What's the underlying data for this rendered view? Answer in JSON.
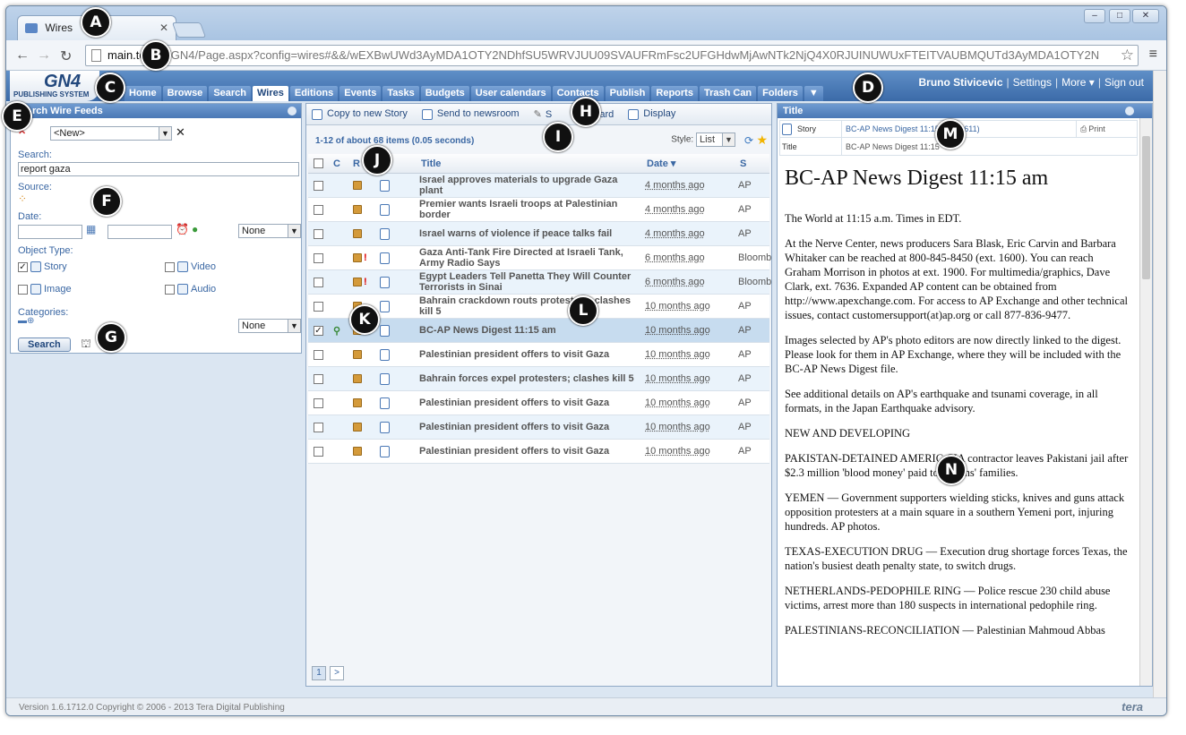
{
  "browser": {
    "tab_title": "Wires",
    "url_host": "main.te",
    "url_rest": "com/GN4/Page.aspx?config=wires#&&/wEXBwUWd3AyMDA1OTY2NDhfSU5WRVJUU09SVAUFRmFsc2UFGHdwMjAwNTk2NjQ4X0RJUINUWUxFTEITVAUBMQUTd3AyMDA1OTY2N"
  },
  "app": {
    "logo_text": "GN4",
    "logo_sub": "PUBLISHING SYSTEM",
    "nav": [
      "Home",
      "Browse",
      "Search",
      "Wires",
      "Editions",
      "Events",
      "Tasks",
      "Budgets",
      "User calendars",
      "Contacts",
      "Publish",
      "Reports",
      "Trash Can",
      "Folders",
      "▼"
    ],
    "active_nav": "Wires",
    "user": "Bruno Stivicevic",
    "settings": "Settings",
    "more": "More ▾",
    "signout": "Sign out"
  },
  "search_panel": {
    "title": "rch Wire Feeds",
    "saved_search": "<New>",
    "search_label": "Search:",
    "search_value": "report gaza",
    "source_label": "Source:",
    "date_label": "Date:",
    "date_mode": "None",
    "object_type_label": "Object Type:",
    "types": [
      {
        "label": "Story",
        "checked": true
      },
      {
        "label": "Video",
        "checked": false
      },
      {
        "label": "Image",
        "checked": false
      },
      {
        "label": "Audio",
        "checked": false
      }
    ],
    "categories_label": "Categories:",
    "categories_mode": "None",
    "search_button": "Search"
  },
  "results_panel": {
    "toolbar": [
      "Copy to new Story",
      "Send to newsroom",
      "S",
      "Clipboard",
      "Display"
    ],
    "info": "1-12 of about 68 items (0.05 seconds)",
    "style_label": "Style:",
    "style_value": "List",
    "columns": {
      "c": "C",
      "r": "R",
      "title": "Title",
      "date": "Date ▾",
      "source": "S"
    },
    "rows": [
      {
        "title": "Israel approves materials to upgrade Gaza plant",
        "date": "4 months ago",
        "source": "AP",
        "flag": false,
        "checked": false
      },
      {
        "title": "Premier wants Israeli troops at Palestinian border",
        "date": "4 months ago",
        "source": "AP",
        "flag": false,
        "checked": false
      },
      {
        "title": "Israel warns of violence if peace talks fail",
        "date": "4 months ago",
        "source": "AP",
        "flag": false,
        "checked": false
      },
      {
        "title": "Gaza Anti-Tank Fire Directed at Israeli Tank, Army Radio Says",
        "date": "6 months ago",
        "source": "Bloomb",
        "flag": true,
        "checked": false
      },
      {
        "title": "Egypt Leaders Tell Panetta They Will Counter Terrorists in Sinai",
        "date": "6 months ago",
        "source": "Bloomb",
        "flag": true,
        "checked": false
      },
      {
        "title": "Bahrain crackdown routs protesters; clashes kill 5",
        "date": "10 months ago",
        "source": "AP",
        "flag": false,
        "checked": false
      },
      {
        "title": "BC-AP News Digest 11:15 am",
        "date": "10 months ago",
        "source": "AP",
        "flag": false,
        "checked": true
      },
      {
        "title": "Palestinian president offers to visit Gaza",
        "date": "10 months ago",
        "source": "AP",
        "flag": false,
        "checked": false
      },
      {
        "title": "Bahrain forces expel protesters; clashes kill 5",
        "date": "10 months ago",
        "source": "AP",
        "flag": false,
        "checked": false
      },
      {
        "title": "Palestinian president offers to visit Gaza",
        "date": "10 months ago",
        "source": "AP",
        "flag": false,
        "checked": false
      },
      {
        "title": "Palestinian president offers to visit Gaza",
        "date": "10 months ago",
        "source": "AP",
        "flag": false,
        "checked": false
      },
      {
        "title": "Palestinian president offers to visit Gaza",
        "date": "10 months ago",
        "source": "AP",
        "flag": false,
        "checked": false
      }
    ],
    "pages": [
      "1",
      ">"
    ]
  },
  "preview_panel": {
    "title": "Title",
    "meta": [
      {
        "key": "Story",
        "value": "BC-AP News Digest 11:15 ... 128611)",
        "print": "Print"
      },
      {
        "key": "Title",
        "value": "BC-AP News Digest 11:15"
      }
    ],
    "headline": "BC-AP News Digest 11:15 am",
    "paragraphs": [
      "The World at 11:15 a.m. Times in EDT.",
      "At the Nerve Center, news producers Sara Blask, Eric Carvin and Barbara Whitaker can be reached at 800-845-8450 (ext. 1600). You can reach Graham Morrison in photos at ext. 1900. For multimedia/graphics, Dave Clark, ext. 7636. Expanded AP content can be obtained from http://www.apexchange.com. For access to AP Exchange and other technical issues, contact customersupport(at)ap.org or call 877-836-9477.",
      "Images selected by AP's photo editors are now directly linked to the digest. Please look for them in AP Exchange, where they will be included with the BC-AP News Digest file.",
      "See additional details on AP's earthquake and tsunami coverage, in all formats, in the Japan Earthquake advisory.",
      "NEW AND DEVELOPING",
      "PAKISTAN-DETAINED AMERIC CIA contractor leaves Pakistani jail after $2.3 million 'blood money' paid to victims' families.",
      "YEMEN — Government supporters wielding sticks, knives and guns attack opposition protesters at a main square in a southern Yemeni port, injuring hundreds. AP photos.",
      "TEXAS-EXECUTION DRUG — Execution drug shortage forces Texas, the nation's busiest death penalty state, to switch drugs.",
      "NETHERLANDS-PEDOPHILE RING — Police rescue 230 child abuse victims, arrest more than 180 suspects in international pedophile ring.",
      "PALESTINIANS-RECONCILIATION — Palestinian Mahmoud Abbas"
    ]
  },
  "footer": {
    "version": "Version 1.6.1712.0 Copyright © 2006 - 2013 Tera Digital Publishing",
    "brand": "tera"
  },
  "callouts": [
    "A",
    "B",
    "C",
    "D",
    "E",
    "F",
    "G",
    "H",
    "I",
    "J",
    "K",
    "L",
    "M",
    "N"
  ]
}
